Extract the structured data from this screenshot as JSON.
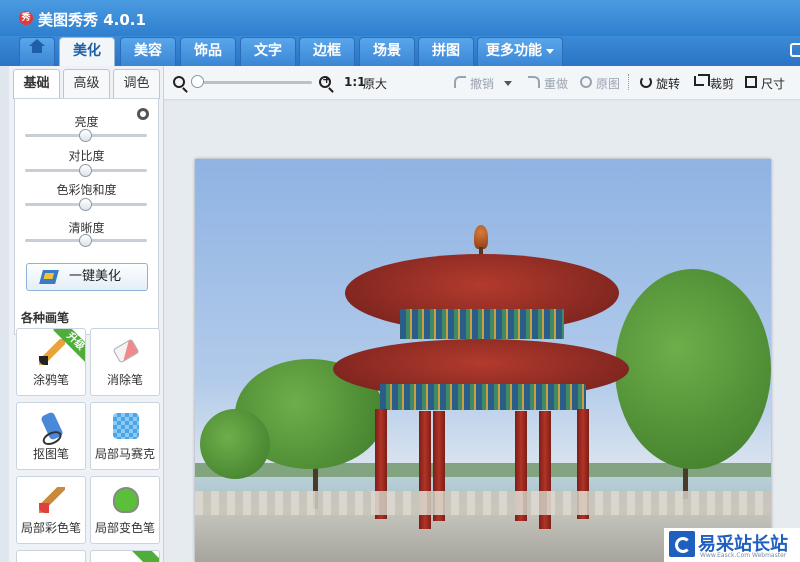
{
  "app": {
    "title": "美图秀秀 4.0.1",
    "logo_text": "秀"
  },
  "tabs": [
    {
      "label": ""
    },
    {
      "label": "美化"
    },
    {
      "label": "美容"
    },
    {
      "label": "饰品"
    },
    {
      "label": "文字"
    },
    {
      "label": "边框"
    },
    {
      "label": "场景"
    },
    {
      "label": "拼图"
    },
    {
      "label": "更多功能"
    }
  ],
  "subtabs": [
    {
      "label": "基础"
    },
    {
      "label": "高级"
    },
    {
      "label": "调色"
    }
  ],
  "adjustments": [
    {
      "label": "亮度",
      "value": 0.5
    },
    {
      "label": "对比度",
      "value": 0.5
    },
    {
      "label": "色彩饱和度",
      "value": 0.5
    },
    {
      "label": "清晰度",
      "value": 0.5
    }
  ],
  "beautify_button": "一键美化",
  "brushes": {
    "title": "各种画笔",
    "items": [
      {
        "label": "涂鸦笔",
        "badge": "升级"
      },
      {
        "label": "消除笔"
      },
      {
        "label": "抠图笔"
      },
      {
        "label": "局部马赛克"
      },
      {
        "label": "局部彩色笔"
      },
      {
        "label": "局部变色笔"
      }
    ]
  },
  "toolbar": {
    "ratio": "1:1",
    "original_size": "原大",
    "undo": "撤销",
    "redo": "重做",
    "original": "原图",
    "rotate": "旋转",
    "crop": "裁剪",
    "size": "尺寸",
    "zoom_level": 0.03
  },
  "watermark": {
    "text": "易采站长站",
    "sub": "Www.Easck.Com Webmaster"
  },
  "colors": {
    "titlebar": "#3a8cdc",
    "accent": "#1f5fa8",
    "badge": "#4fae3a"
  }
}
